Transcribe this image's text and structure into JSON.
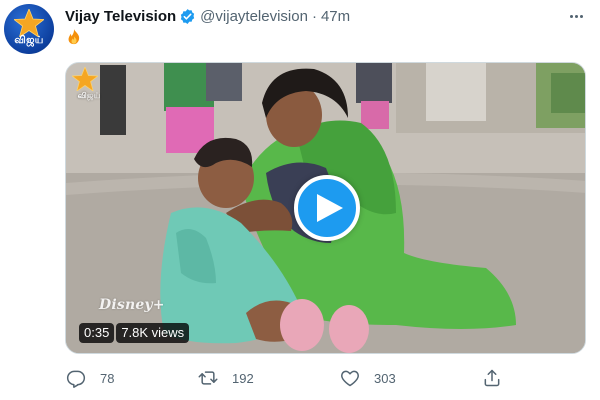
{
  "account": {
    "display_name": "Vijay Television",
    "handle": "@vijaytelevision",
    "separator": "·",
    "timestamp": "47m",
    "verified": true,
    "avatar_text": "விஜய்"
  },
  "tweet": {
    "text_emoji": "fire-emoji"
  },
  "media": {
    "channel_logo_text": "விஜய்",
    "watermark": "Disney+",
    "duration": "0:35",
    "views": "7.8K views"
  },
  "actions": {
    "replies": "78",
    "retweets": "192",
    "likes": "303"
  },
  "colors": {
    "accent": "#1d9bf0",
    "secondary_text": "#536471",
    "avatar_bg": "#0d3f9e",
    "star": "#f5a623"
  },
  "icons": [
    "verified-badge-icon",
    "more-icon",
    "fire-icon",
    "play-icon",
    "reply-icon",
    "retweet-icon",
    "like-icon",
    "share-icon"
  ]
}
